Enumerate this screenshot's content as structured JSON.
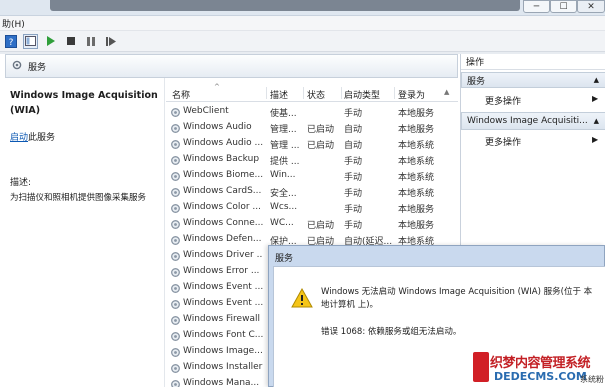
{
  "window": {
    "controls": {
      "minimize": "─",
      "maximize": "☐",
      "close": "✕"
    }
  },
  "menubar": {
    "help": "助(H)"
  },
  "toolbar": {
    "icons": [
      "help-icon",
      "panel-icon",
      "play-icon",
      "stop-icon",
      "pause-icon",
      "restart-icon"
    ]
  },
  "scope": {
    "title": "服务"
  },
  "description": {
    "service_name": "Windows Image Acquisition (WIA)",
    "start_link": "启动",
    "start_suffix": "此服务",
    "label": "描述:",
    "text": "为扫描仪和照相机提供图像采集服务"
  },
  "list": {
    "headers": {
      "name": "名称",
      "desc": "描述",
      "status": "状态",
      "start": "启动类型",
      "logon": "登录为"
    },
    "rows": [
      {
        "name": "WebClient",
        "desc": "使基...",
        "status": "",
        "start": "手动",
        "logon": "本地服务"
      },
      {
        "name": "Windows Audio",
        "desc": "管理...",
        "status": "已启动",
        "start": "自动",
        "logon": "本地服务"
      },
      {
        "name": "Windows Audio ...",
        "desc": "管理 ...",
        "status": "已启动",
        "start": "自动",
        "logon": "本地系统"
      },
      {
        "name": "Windows Backup",
        "desc": "提供 ...",
        "status": "",
        "start": "手动",
        "logon": "本地系统"
      },
      {
        "name": "Windows Biome...",
        "desc": "Win...",
        "status": "",
        "start": "手动",
        "logon": "本地系统"
      },
      {
        "name": "Windows CardS...",
        "desc": "安全...",
        "status": "",
        "start": "手动",
        "logon": "本地系统"
      },
      {
        "name": "Windows Color ...",
        "desc": "Wcs...",
        "status": "",
        "start": "手动",
        "logon": "本地服务"
      },
      {
        "name": "Windows Conne...",
        "desc": "WC...",
        "status": "已启动",
        "start": "手动",
        "logon": "本地服务"
      },
      {
        "name": "Windows Defen...",
        "desc": "保护...",
        "status": "已启动",
        "start": "自动(延迟...",
        "logon": "本地系统"
      },
      {
        "name": "Windows Driver ...",
        "desc": "",
        "status": "",
        "start": "",
        "logon": ""
      },
      {
        "name": "Windows Error ...",
        "desc": "",
        "status": "",
        "start": "",
        "logon": ""
      },
      {
        "name": "Windows Event ...",
        "desc": "",
        "status": "",
        "start": "",
        "logon": ""
      },
      {
        "name": "Windows Event ...",
        "desc": "",
        "status": "",
        "start": "",
        "logon": ""
      },
      {
        "name": "Windows Firewall",
        "desc": "",
        "status": "",
        "start": "",
        "logon": ""
      },
      {
        "name": "Windows Font C...",
        "desc": "",
        "status": "",
        "start": "",
        "logon": ""
      },
      {
        "name": "Windows Image...",
        "desc": "",
        "status": "",
        "start": "",
        "logon": ""
      },
      {
        "name": "Windows Installer",
        "desc": "",
        "status": "",
        "start": "",
        "logon": ""
      },
      {
        "name": "Windows Mana...",
        "desc": "",
        "status": "",
        "start": "",
        "logon": ""
      }
    ]
  },
  "actions": {
    "title": "操作",
    "group1": "服务",
    "more1": "更多操作",
    "group2": "Windows Image Acquisiti...",
    "more2": "更多操作"
  },
  "dialog": {
    "title": "服务",
    "message_line1": "Windows 无法启动 Windows Image Acquisition (WIA) 服务(位于 本",
    "message_line2": "地计算机 上)。",
    "error": "错误 1068: 依赖服务或组无法启动。"
  },
  "watermark": {
    "line1": "织梦内容管理系统",
    "line2": "DEDECMS.COM",
    "tag": "系统粉"
  },
  "colors": {
    "link": "#0b58b3",
    "accent": "#c32025",
    "selection": "#dce5ef"
  }
}
